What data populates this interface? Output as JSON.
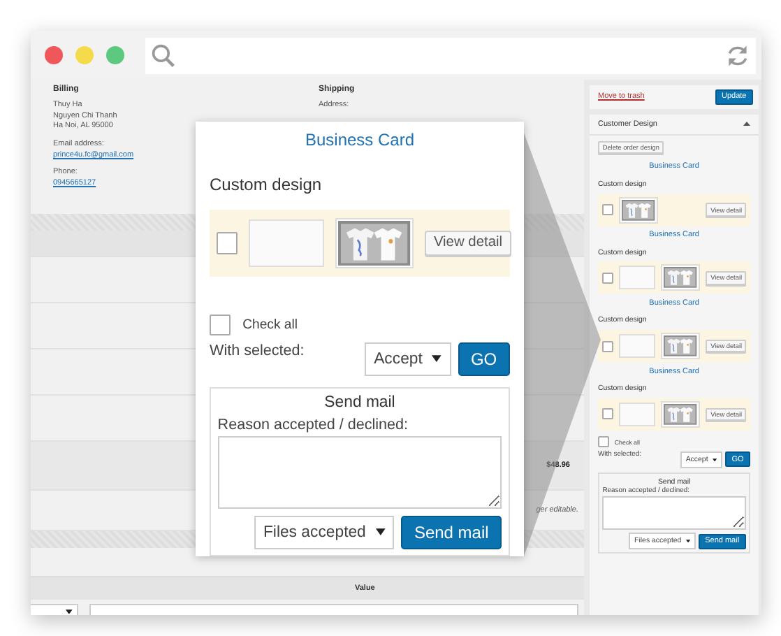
{
  "order": {
    "billing": {
      "title": "Billing",
      "lines": [
        "Thuy Ha",
        "Nguyen Chi Thanh",
        "Ha Noi, AL 95000"
      ],
      "email_label": "Email address:",
      "email": "prince4u.fc@gmail.com",
      "phone_label": "Phone:",
      "phone": "0945665127"
    },
    "shipping": {
      "title": "Shipping",
      "address_label": "Address:"
    },
    "total": "$48.96",
    "note": "ger editable.",
    "meta_header": "Value"
  },
  "sidebar": {
    "trash_link": "Move to trash",
    "update_button": "Update",
    "panel": {
      "title": "Customer Design",
      "expanded": true,
      "delete_button": "Delete order design",
      "design": {
        "groups": [
          {
            "title": "Business Card",
            "label": "Custom design",
            "items": [
              {
                "kind": "thumb",
                "checked": false,
                "button": "View detail"
              }
            ]
          },
          {
            "title": "Business Card",
            "label": "Custom design",
            "items": [
              {
                "kind": "upload",
                "checked": false,
                "button": "View detail"
              }
            ]
          },
          {
            "title": "Business Card",
            "label": "Custom design",
            "items": [
              {
                "kind": "upload",
                "checked": false,
                "button": "View detail"
              }
            ]
          },
          {
            "title": "Business Card",
            "label": "Custom design",
            "items": [
              {
                "kind": "upload",
                "checked": false,
                "button": "View detail"
              }
            ]
          }
        ],
        "check_all": {
          "label": "Check all",
          "checked": false
        },
        "with_selected": "With selected:",
        "action": "Accept",
        "go": "GO",
        "mail": {
          "title": "Send mail",
          "reason_label": "Reason accepted / declined:",
          "files": "Files accepted",
          "send": "Send mail"
        }
      }
    }
  },
  "popup": {
    "design": {
      "groups": [
        {
          "title": "Business Card",
          "label": "Custom design",
          "items": [
            {
              "kind": "upload",
              "checked": false,
              "button": "View detail"
            }
          ]
        }
      ],
      "check_all": {
        "label": "Check all",
        "checked": false
      },
      "with_selected": "With selected:",
      "action": "Accept",
      "go": "GO",
      "mail": {
        "title": "Send mail",
        "reason_label": "Reason accepted / declined:",
        "files": "Files accepted",
        "send": "Send mail"
      }
    }
  }
}
